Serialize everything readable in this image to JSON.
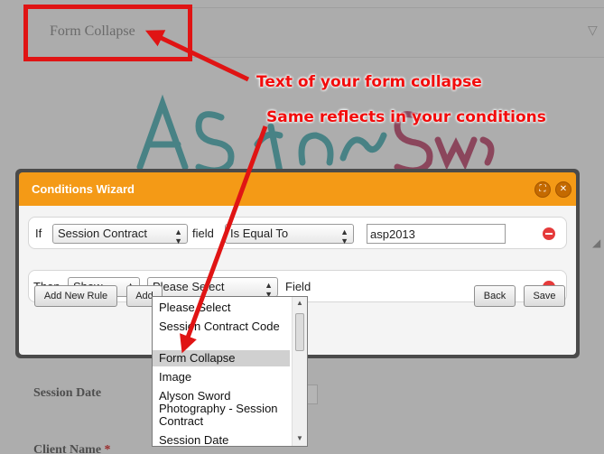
{
  "form": {
    "collapse_title": "Form Collapse",
    "session_date_label": "Session Date",
    "client_name_label": "Client Name",
    "required_mark": "*"
  },
  "wizard": {
    "title": "Conditions Wizard",
    "if_row": {
      "if_label": "If",
      "field_select": "Session Contract",
      "field_word": "field",
      "operator_select": "Is Equal To",
      "value": "asp2013"
    },
    "then_row": {
      "then_label": "Then",
      "action_select": "Show",
      "target_select": "Please Select",
      "field_word": "Field"
    },
    "buttons": {
      "add_new_rule": "Add New Rule",
      "add_partial": "Add",
      "back": "Back",
      "save": "Save"
    }
  },
  "dropdown": {
    "options": [
      "Please Select",
      "Session Contract Code",
      "Form Collapse",
      "Image",
      "Alyson Sword Photography - Session Contract",
      "Session Date"
    ],
    "selected": "Form Collapse"
  },
  "annotations": {
    "line1": "Text of your form collapse",
    "line2": "Same reflects in your conditions",
    "color": "#f20c0c"
  }
}
